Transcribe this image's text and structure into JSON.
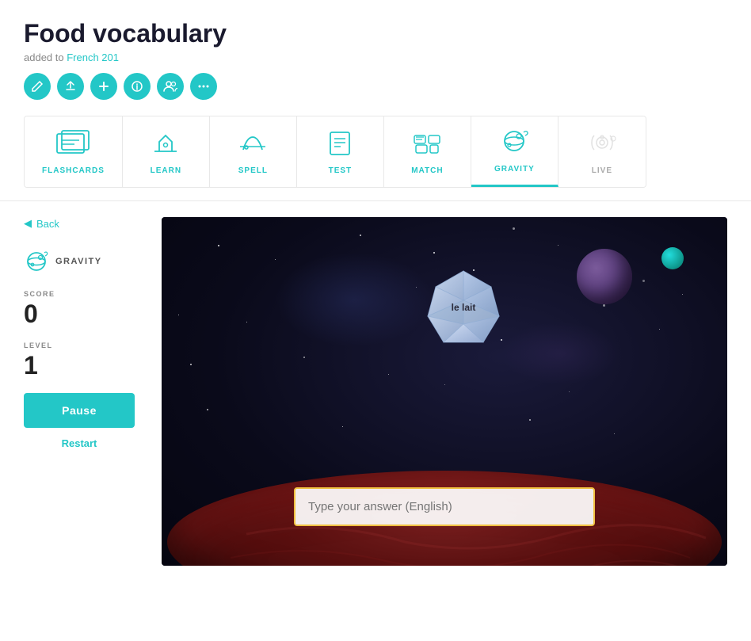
{
  "header": {
    "title": "Food vocabulary",
    "added_to_label": "added to",
    "added_to_link": "French 201"
  },
  "action_icons": [
    {
      "name": "edit-icon",
      "symbol": "✏",
      "label": "Edit"
    },
    {
      "name": "share-icon",
      "symbol": "↗",
      "label": "Share"
    },
    {
      "name": "add-icon",
      "symbol": "+",
      "label": "Add"
    },
    {
      "name": "info-icon",
      "symbol": "i",
      "label": "Info"
    },
    {
      "name": "users-icon",
      "symbol": "👥",
      "label": "Users"
    },
    {
      "name": "more-icon",
      "symbol": "···",
      "label": "More"
    }
  ],
  "study_modes": [
    {
      "id": "flashcards",
      "label": "FLASHCARDS",
      "active": false,
      "disabled": false
    },
    {
      "id": "learn",
      "label": "LEARN",
      "active": false,
      "disabled": false
    },
    {
      "id": "spell",
      "label": "SPELL",
      "active": false,
      "disabled": false
    },
    {
      "id": "test",
      "label": "TEST",
      "active": false,
      "disabled": false
    },
    {
      "id": "match",
      "label": "MATCH",
      "active": false,
      "disabled": false
    },
    {
      "id": "gravity",
      "label": "GRAVITY",
      "active": true,
      "disabled": false
    },
    {
      "id": "live",
      "label": "LIVE",
      "active": false,
      "disabled": true
    }
  ],
  "sidebar": {
    "back_label": "Back",
    "mode_label": "GRAVITY",
    "score_label": "SCORE",
    "score_value": "0",
    "level_label": "LEVEL",
    "level_value": "1",
    "pause_label": "Pause",
    "restart_label": "Restart"
  },
  "game": {
    "falling_word": "le lait",
    "input_placeholder": "Type your answer (English)"
  },
  "colors": {
    "teal": "#23c7c7",
    "active_border": "#23c7c7",
    "answer_border": "#f0c040"
  }
}
